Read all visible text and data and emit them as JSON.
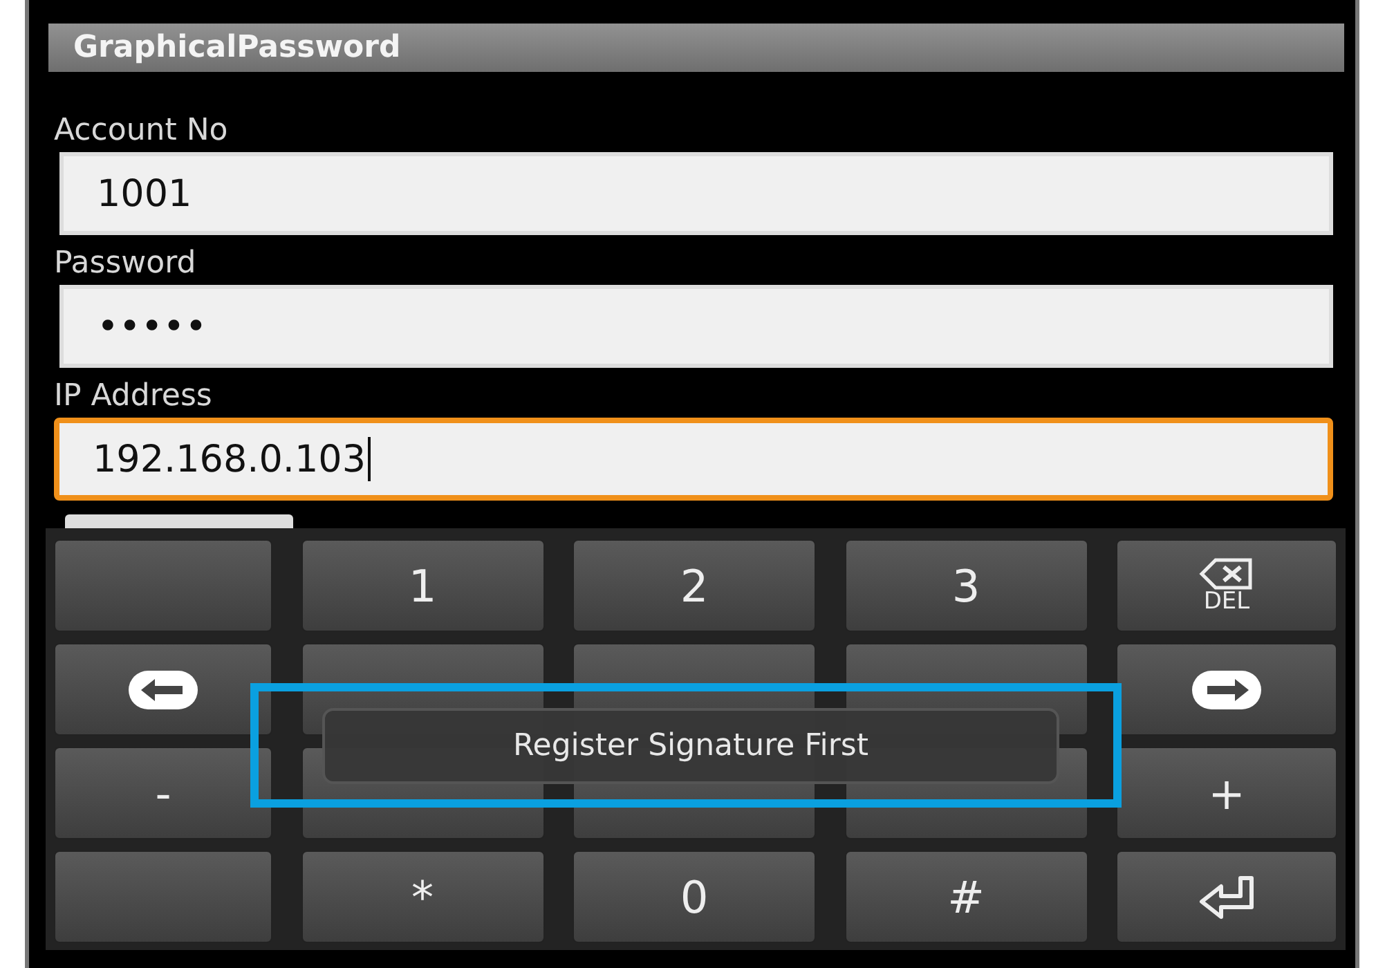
{
  "window": {
    "title": "GraphicalPassword"
  },
  "fields": [
    {
      "label": "Account No",
      "value": "1001",
      "focused": false
    },
    {
      "label": "Password",
      "value": "•••••",
      "focused": false
    },
    {
      "label": "IP Address",
      "value": "192.168.0.103",
      "focused": true
    }
  ],
  "keyboard": {
    "rows": [
      [
        {
          "kind": "empty"
        },
        {
          "kind": "char",
          "label": "1"
        },
        {
          "kind": "char",
          "label": "2"
        },
        {
          "kind": "char",
          "label": "3"
        },
        {
          "kind": "del",
          "label": "DEL"
        }
      ],
      [
        {
          "kind": "left"
        },
        {
          "kind": "empty"
        },
        {
          "kind": "empty"
        },
        {
          "kind": "empty"
        },
        {
          "kind": "right"
        }
      ],
      [
        {
          "kind": "char",
          "label": "-"
        },
        {
          "kind": "empty"
        },
        {
          "kind": "empty"
        },
        {
          "kind": "empty"
        },
        {
          "kind": "char",
          "label": "+"
        }
      ],
      [
        {
          "kind": "empty"
        },
        {
          "kind": "char",
          "label": "*"
        },
        {
          "kind": "char",
          "label": "0"
        },
        {
          "kind": "char",
          "label": "#"
        },
        {
          "kind": "enter"
        }
      ]
    ]
  },
  "toast": {
    "message": "Register Signature First"
  }
}
